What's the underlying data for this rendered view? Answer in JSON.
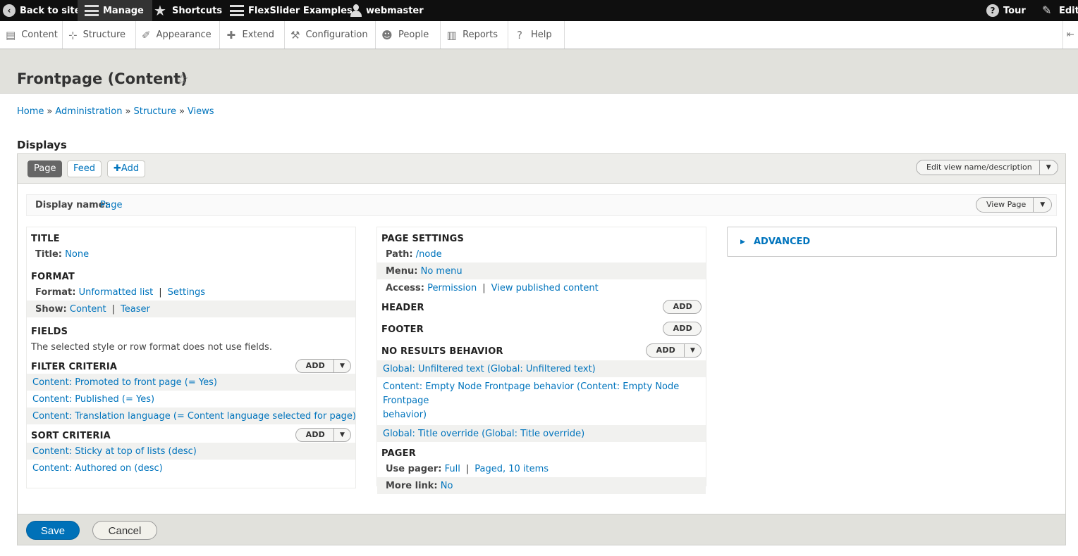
{
  "toolbar": {
    "back": "Back to site",
    "manage": "Manage",
    "shortcuts": "Shortcuts",
    "flexslider": "FlexSlider Examples",
    "user": "webmaster",
    "tour": "Tour",
    "edit": "Edit"
  },
  "tray": {
    "items": [
      "Content",
      "Structure",
      "Appearance",
      "Extend",
      "Configuration",
      "People",
      "Reports",
      "Help"
    ]
  },
  "page": {
    "title": "Frontpage (Content)",
    "breadcrumb": [
      "Home",
      "Administration",
      "Structure",
      "Views"
    ],
    "breadcrumb_sep": "»",
    "displays_label": "Displays"
  },
  "display_tabs": {
    "page": "Page",
    "feed": "Feed",
    "add": "Add",
    "edit_view": "Edit view name/description"
  },
  "display_name": {
    "label": "Display name:",
    "value": "Page",
    "view_button": "View Page"
  },
  "left": {
    "title_head": "TITLE",
    "title_label": "Title:",
    "title_value": "None",
    "format_head": "FORMAT",
    "format_label": "Format:",
    "format_value": "Unformatted list",
    "format_settings": "Settings",
    "show_label": "Show:",
    "show_value": "Content",
    "show_teaser": "Teaser",
    "fields_head": "FIELDS",
    "fields_note": "The selected style or row format does not use fields.",
    "filter_head": "FILTER CRITERIA",
    "filters": [
      "Content: Promoted to front page (= Yes)",
      "Content: Published (= Yes)",
      "Content: Translation language (= Content language selected for page)"
    ],
    "sort_head": "SORT CRITERIA",
    "sorts": [
      "Content: Sticky at top of lists (desc)",
      "Content: Authored on (desc)"
    ],
    "add": "Add"
  },
  "middle": {
    "page_settings_head": "PAGE SETTINGS",
    "path_label": "Path:",
    "path_value": "/node",
    "menu_label": "Menu:",
    "menu_value": "No menu",
    "access_label": "Access:",
    "access_value": "Permission",
    "access_perm": "View published content",
    "header_head": "HEADER",
    "footer_head": "FOOTER",
    "no_results_head": "NO RESULTS BEHAVIOR",
    "no_results": [
      "Global: Unfiltered text (Global: Unfiltered text)",
      "Content: Empty Node Frontpage behavior (Content: Empty Node Frontpage",
      "behavior)",
      "Global: Title override (Global: Title override)"
    ],
    "pager_head": "PAGER",
    "use_pager_label": "Use pager:",
    "use_pager_value": "Full",
    "use_pager_items": "Paged, 10 items",
    "more_link_label": "More link:",
    "more_link_value": "No",
    "add": "Add"
  },
  "advanced": {
    "label": "ADVANCED"
  },
  "actions": {
    "save": "Save",
    "cancel": "Cancel"
  }
}
